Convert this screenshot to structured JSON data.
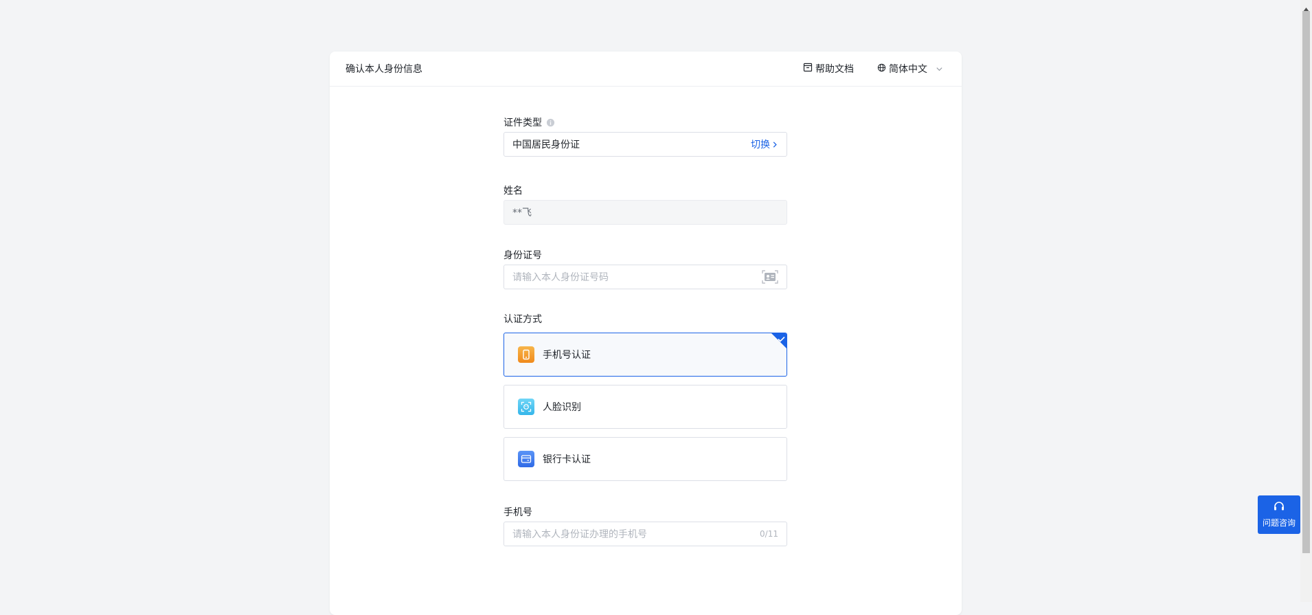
{
  "header": {
    "title": "确认本人身份信息",
    "help_doc": "帮助文档",
    "language": "简体中文"
  },
  "form": {
    "cert_type": {
      "label": "证件类型",
      "value": "中国居民身份证",
      "switch": "切换"
    },
    "name": {
      "label": "姓名",
      "value": "**飞"
    },
    "id_number": {
      "label": "身份证号",
      "placeholder": "请输入本人身份证号码"
    },
    "auth_method": {
      "label": "认证方式",
      "options": [
        {
          "label": "手机号认证",
          "icon": "phone-icon",
          "color": "#f59a23",
          "selected": true
        },
        {
          "label": "人脸识别",
          "icon": "face-scan-icon",
          "color": "#3fc4f0",
          "selected": false
        },
        {
          "label": "银行卡认证",
          "icon": "bank-card-icon",
          "color": "#3a7af2",
          "selected": false
        }
      ]
    },
    "phone": {
      "label": "手机号",
      "placeholder": "请输入本人身份证办理的手机号",
      "counter": "0/11"
    }
  },
  "float_help": {
    "label": "问题咨询"
  },
  "colors": {
    "accent": "#1b63e6",
    "background": "#f3f4f6"
  }
}
